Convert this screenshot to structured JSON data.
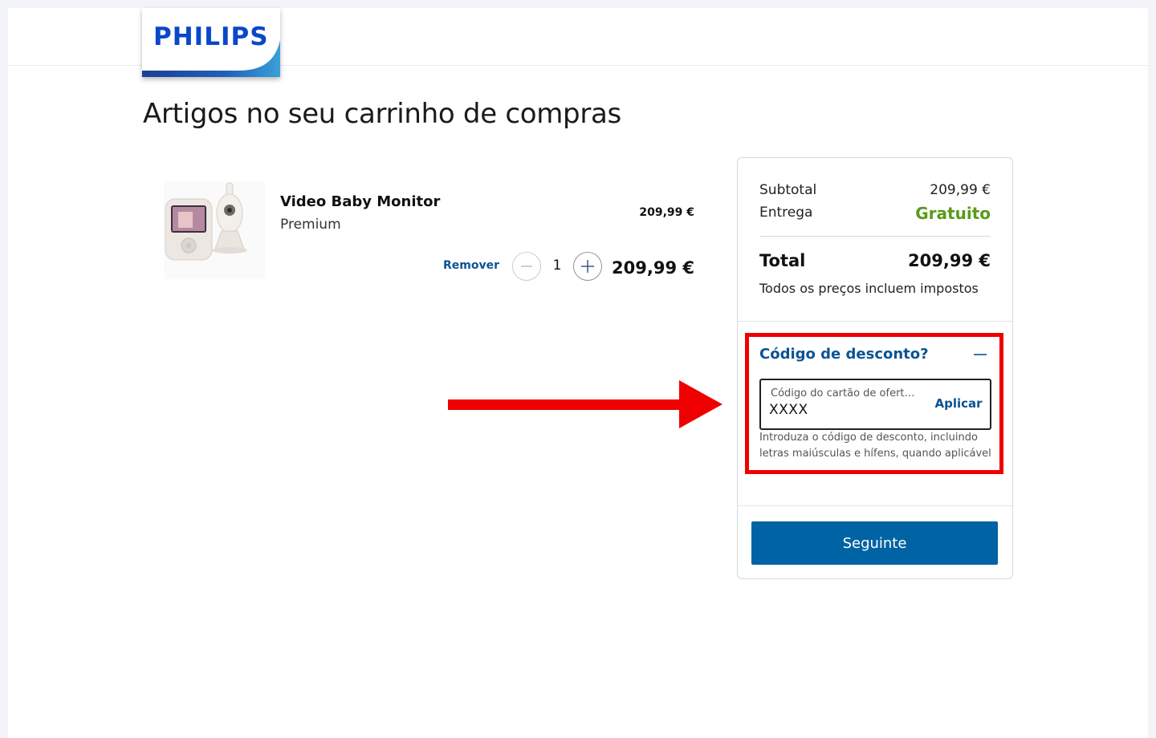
{
  "header": {
    "brand": "PHILIPS"
  },
  "page": {
    "title": "Artigos no seu carrinho de compras"
  },
  "cart_item": {
    "name": "Video Baby Monitor",
    "variant": "Premium",
    "unit_price": "209,99 €",
    "remove_label": "Remover",
    "quantity": "1",
    "line_total": "209,99 €",
    "image_icon": "baby-monitor-product-image"
  },
  "summary": {
    "subtotal_label": "Subtotal",
    "subtotal_value": "209,99 €",
    "shipping_label": "Entrega",
    "shipping_value": "Gratuito",
    "total_label": "Total",
    "total_value": "209,99 €",
    "tax_note": "Todos os preços incluem impostos"
  },
  "discount": {
    "title": "Código de desconto?",
    "input_label": "Código do cartão de ofert…",
    "input_value": "XXXX",
    "apply_label": "Aplicar",
    "helper_text": "Introduza o código de desconto, incluindo letras maiúsculas e hífens, quando aplicável"
  },
  "actions": {
    "next_label": "Seguinte"
  },
  "colors": {
    "brand_blue": "#0a47c9",
    "link_blue": "#0b5394",
    "button_blue": "#0063a3",
    "free_green": "#5a9a1a",
    "annotation_red": "#ee0000"
  }
}
